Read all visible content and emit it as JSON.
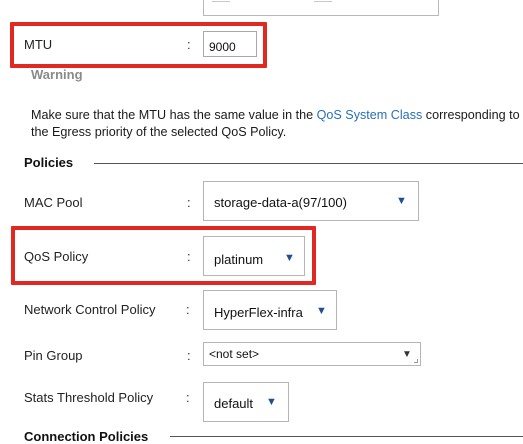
{
  "mtu": {
    "label": "MTU",
    "colon": ":",
    "value": "9000"
  },
  "warning": {
    "title": "Warning",
    "text_before": "Make sure that the MTU has the same value in the ",
    "link": "QoS System Class",
    "text_after": " corresponding to the Egress priority of the selected QoS Policy."
  },
  "policies": {
    "title": "Policies",
    "fields": [
      {
        "label": "MAC Pool",
        "colon": ":",
        "value": "storage-data-a(97/100)"
      },
      {
        "label": "QoS Policy",
        "colon": ":",
        "value": "platinum"
      },
      {
        "label": "Network Control Policy",
        "colon": ":",
        "value": "HyperFlex-infra"
      },
      {
        "label": "Pin Group",
        "colon": ":",
        "value": "<not set>"
      },
      {
        "label": "Stats Threshold Policy",
        "colon": ":",
        "value": "default"
      }
    ]
  },
  "connection_policies": {
    "title": "Connection Policies"
  },
  "colors": {
    "highlight": "#e02a21",
    "link": "#2a6fb5",
    "dropdown_arrow": "#1f4f8f"
  },
  "icons": {
    "dropdown": "triangle-down"
  }
}
